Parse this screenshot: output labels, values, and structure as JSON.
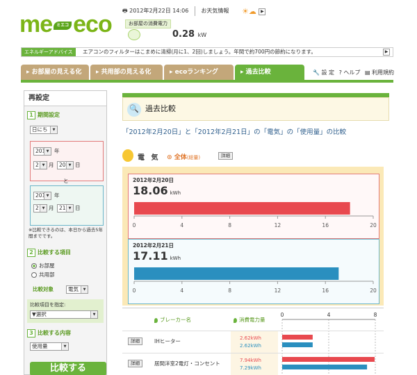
{
  "logo": {
    "left": "me",
    "mark": "ミエコ",
    "right": "eco"
  },
  "header": {
    "datetime": "2012年2月22日 14:06",
    "weather_label": "お天気情報",
    "weather_icons": "☀☁",
    "power_label": "お部屋の消費電力",
    "power_value": "0.28",
    "power_unit": "kW"
  },
  "advice": {
    "tag": "エネルギーアドバイス",
    "text": "エアコンのフィルターはこまめに清掃(月に1、2回)しましょう。年間で約700円の節約になります。"
  },
  "nav": {
    "tabs": [
      {
        "label": "お部屋の見える化"
      },
      {
        "label": "共用部の見える化"
      },
      {
        "label": "ecoランキング"
      },
      {
        "label": "過去比較"
      }
    ],
    "settings": "設 定",
    "help": "ヘルプ",
    "terms": "利用規約"
  },
  "left": {
    "title": "再設定",
    "period_label": "期間設定",
    "period_unit": "日にち",
    "date1": {
      "year": "2012",
      "year_suffix": "年",
      "month": "2",
      "month_suffix": "月",
      "day": "20",
      "day_suffix": "日"
    },
    "and_label": "と",
    "date2": {
      "year": "2012",
      "year_suffix": "年",
      "month": "2",
      "month_suffix": "月",
      "day": "21",
      "day_suffix": "日"
    },
    "note": "※比較できるのは、本日から過去5年間までです。",
    "items_label": "比較する項目",
    "radio_room": "お部屋",
    "radio_common": "共用部",
    "target_label": "比較対象",
    "target_value": "電気",
    "compare_items_label": "比較項目を指定:",
    "compare_items_value": "▼選択",
    "content_label": "比較する内容",
    "content_value": "使用量",
    "compare_button": "比較する"
  },
  "main": {
    "title": "過去比較",
    "compare_text": "「2012年2月20日」と「2012年2月21日」の「電気」の「使用量」の比較",
    "section_name": "電 気",
    "scope": "全体",
    "scope_sub": "(総量)",
    "detail": "詳細"
  },
  "chart_data": [
    {
      "type": "bar",
      "title": "2012年2月20日",
      "value_label": "18.06",
      "unit": "kWh",
      "values": [
        18.06
      ],
      "xlim": [
        0,
        20
      ],
      "ticks": [
        0,
        4,
        8,
        12,
        16,
        20
      ],
      "color": "#e8494f"
    },
    {
      "type": "bar",
      "title": "2012年2月21日",
      "value_label": "17.11",
      "unit": "kWh",
      "values": [
        17.11
      ],
      "xlim": [
        0,
        20
      ],
      "ticks": [
        0,
        4,
        8,
        12,
        16,
        20
      ],
      "color": "#2a8fbf"
    }
  ],
  "table": {
    "col_breaker": "ブレーカー名",
    "col_power": "消費電力量",
    "ticks": [
      0,
      4,
      8
    ],
    "rows": [
      {
        "detail": "詳細",
        "name": "IHヒーター",
        "v1": "2.62kWh",
        "v2": "2.62kWh",
        "a": 2.62,
        "b": 2.62
      },
      {
        "detail": "詳細",
        "name": "居間洋室2電灯・コンセント",
        "v1": "7.94kWh",
        "v2": "7.29kWh",
        "a": 7.94,
        "b": 7.29
      }
    ],
    "max": 8
  },
  "colors": {
    "accent": "#6ab33c",
    "tab": "#c3a77a",
    "red": "#e8494f",
    "blue": "#2a8fbf"
  }
}
